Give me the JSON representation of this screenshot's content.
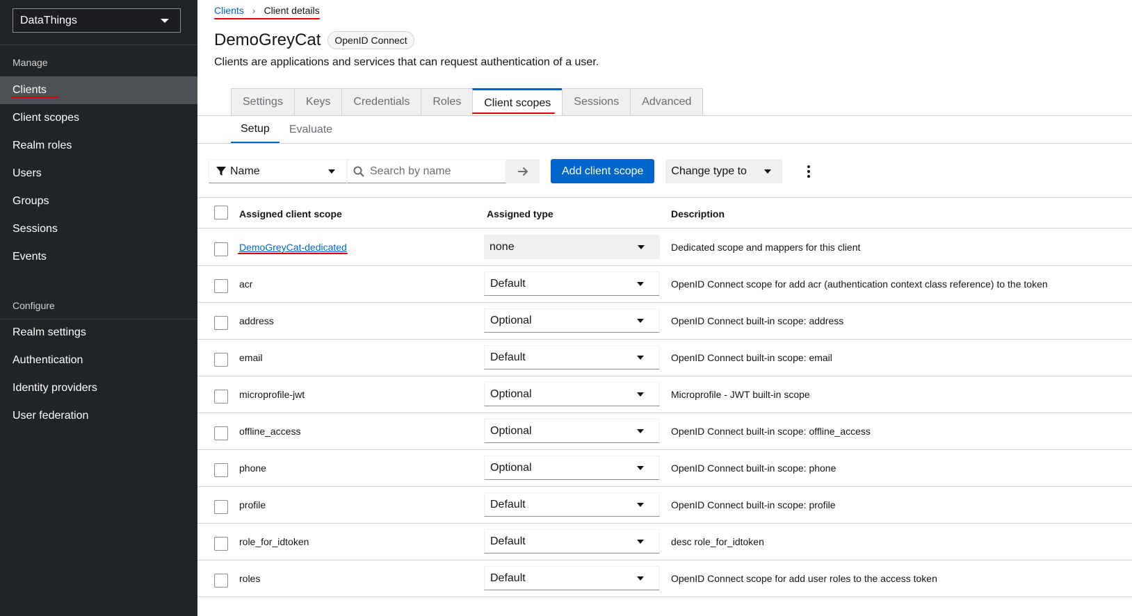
{
  "sidebar": {
    "realm": "DataThings",
    "sections": [
      {
        "title": "Manage",
        "items": [
          "Clients",
          "Client scopes",
          "Realm roles",
          "Users",
          "Groups",
          "Sessions",
          "Events"
        ]
      },
      {
        "title": "Configure",
        "items": [
          "Realm settings",
          "Authentication",
          "Identity providers",
          "User federation"
        ]
      }
    ]
  },
  "breadcrumb": {
    "root": "Clients",
    "current": "Client details"
  },
  "header": {
    "title": "DemoGreyCat",
    "badge": "OpenID Connect",
    "description": "Clients are applications and services that can request authentication of a user."
  },
  "tabs": [
    "Settings",
    "Keys",
    "Credentials",
    "Roles",
    "Client scopes",
    "Sessions",
    "Advanced"
  ],
  "subtabs": [
    "Setup",
    "Evaluate"
  ],
  "toolbar": {
    "filter_label": "Name",
    "search_placeholder": "Search by name",
    "add_button": "Add client scope",
    "change_type": "Change type to"
  },
  "table": {
    "headers": [
      "Assigned client scope",
      "Assigned type",
      "Description"
    ],
    "rows": [
      {
        "name": "DemoGreyCat-dedicated",
        "type": "none",
        "desc": "Dedicated scope and mappers for this client"
      },
      {
        "name": "acr",
        "type": "Default",
        "desc": "OpenID Connect scope for add acr (authentication context class reference) to the token"
      },
      {
        "name": "address",
        "type": "Optional",
        "desc": "OpenID Connect built-in scope: address"
      },
      {
        "name": "email",
        "type": "Default",
        "desc": "OpenID Connect built-in scope: email"
      },
      {
        "name": "microprofile-jwt",
        "type": "Optional",
        "desc": "Microprofile - JWT built-in scope"
      },
      {
        "name": "offline_access",
        "type": "Optional",
        "desc": "OpenID Connect built-in scope: offline_access"
      },
      {
        "name": "phone",
        "type": "Optional",
        "desc": "OpenID Connect built-in scope: phone"
      },
      {
        "name": "profile",
        "type": "Default",
        "desc": "OpenID Connect built-in scope: profile"
      },
      {
        "name": "role_for_idtoken",
        "type": "Default",
        "desc": "desc role_for_idtoken"
      },
      {
        "name": "roles",
        "type": "Default",
        "desc": "OpenID Connect scope for add user roles to the access token"
      }
    ]
  },
  "colors": {
    "accent": "#0066cc",
    "sidebar_bg": "#212427",
    "annotation": "#e00000"
  }
}
